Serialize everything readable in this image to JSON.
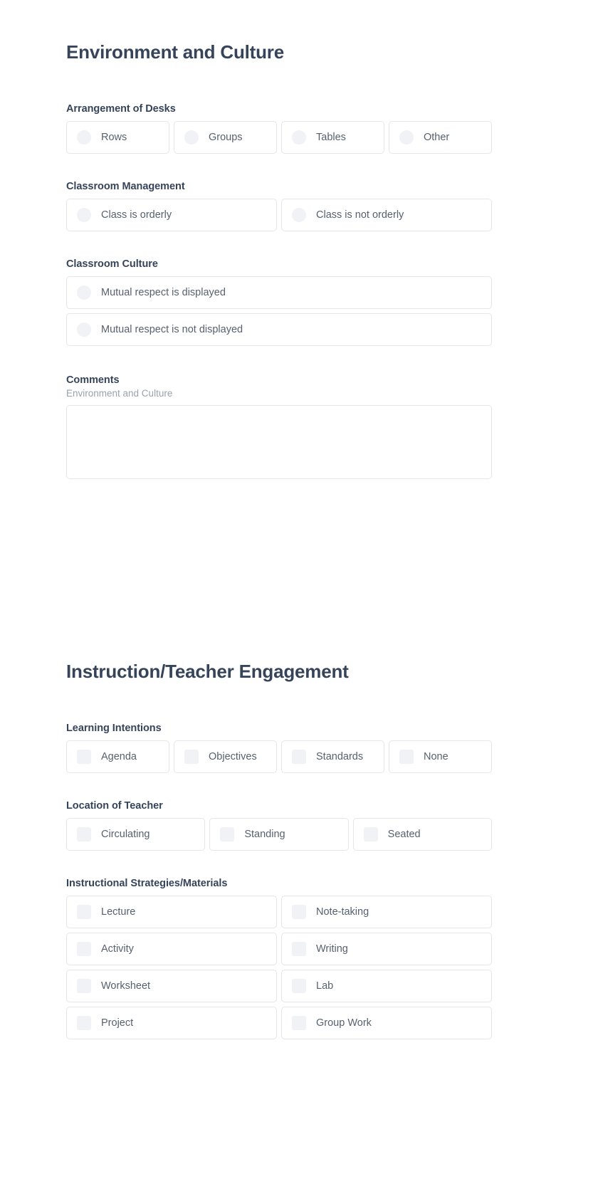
{
  "sections": [
    {
      "id": "environment-and-culture",
      "title": "Environment and Culture",
      "groups": [
        {
          "id": "arrangement-of-desks",
          "label": "Arrangement of Desks",
          "control": "radio",
          "columns": 4,
          "options": [
            "Rows",
            "Groups",
            "Tables",
            "Other"
          ]
        },
        {
          "id": "classroom-management",
          "label": "Classroom Management",
          "control": "radio",
          "columns": 2,
          "options": [
            "Class is orderly",
            "Class is not orderly"
          ]
        },
        {
          "id": "classroom-culture",
          "label": "Classroom Culture",
          "control": "radio",
          "columns": 1,
          "options": [
            "Mutual respect is displayed",
            "Mutual respect is not displayed"
          ]
        }
      ],
      "comments": {
        "label": "Comments",
        "subtitle": "Environment and Culture",
        "value": "",
        "placeholder": ""
      }
    },
    {
      "id": "instruction-teacher-engagement",
      "title": "Instruction/Teacher Engagement",
      "groups": [
        {
          "id": "learning-intentions",
          "label": "Learning Intentions",
          "control": "checkbox",
          "columns": 4,
          "options": [
            "Agenda",
            "Objectives",
            "Standards",
            "None"
          ]
        },
        {
          "id": "location-of-teacher",
          "label": "Location of Teacher",
          "control": "checkbox",
          "columns": 3,
          "options": [
            "Circulating",
            "Standing",
            "Seated"
          ]
        },
        {
          "id": "instructional-strategies-materials",
          "label": "Instructional Strategies/Materials",
          "control": "checkbox",
          "columns": 2,
          "options": [
            "Lecture",
            "Note-taking",
            "Activity",
            "Writing",
            "Worksheet",
            "Lab",
            "Project",
            "Group Work"
          ]
        }
      ]
    }
  ],
  "colors": {
    "heading": "#36445a",
    "label": "#36445a",
    "option_text": "#56616f",
    "border": "#e4e6e9",
    "indicator": "#f0f2f5",
    "subtitle": "#9aa2ad",
    "background": "#ffffff"
  }
}
